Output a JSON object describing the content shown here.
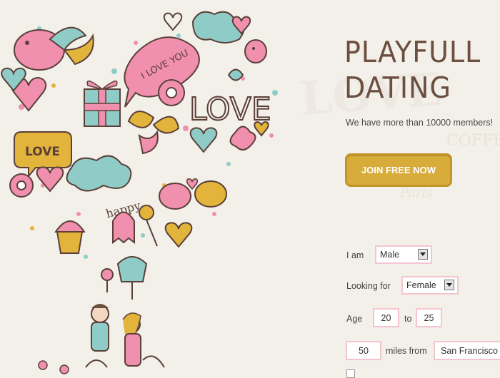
{
  "hero": {
    "title_line1": "PLAYFULL",
    "title_line2": "DATING",
    "subtitle": "We have more than 10000 members!",
    "join_label": "JOIN FREE NOW"
  },
  "illustration": {
    "bubble_i_love_you": "I LOVE YOU",
    "big_love": "LOVE",
    "small_love": "LOVE",
    "happy": "happy"
  },
  "background": {
    "love_word": "LOVE",
    "coffee_word": "COFFEE",
    "paris_word": "Paris"
  },
  "form": {
    "i_am_label": "I am",
    "i_am_value": "Male",
    "looking_for_label": "Looking for",
    "looking_for_value": "Female",
    "age_label": "Age",
    "age_min": "20",
    "age_to_label": "to",
    "age_max": "25",
    "distance_value": "50",
    "miles_from_label": "miles from",
    "location_value": "San Francisco"
  },
  "colors": {
    "accent_gold": "#d7ac3b",
    "title_brown": "#6b4f3f",
    "field_border_pink": "#f3c6cf",
    "pink": "#f08fae",
    "teal": "#8fcbc7"
  }
}
